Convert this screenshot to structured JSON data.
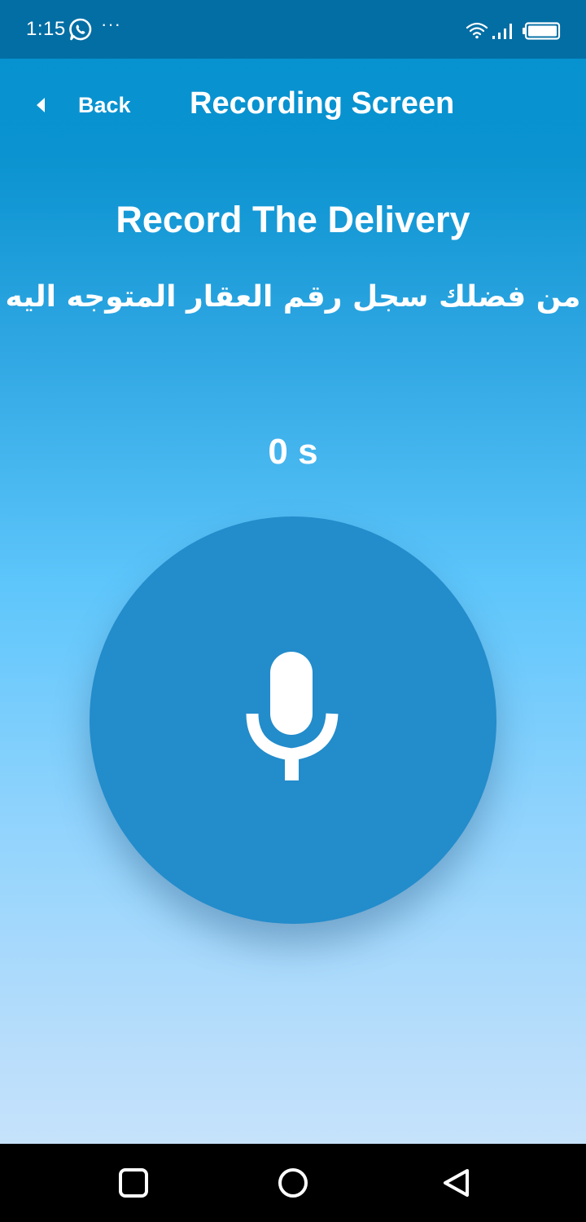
{
  "status_bar": {
    "time": "1:15",
    "more": "···",
    "icons": [
      "whatsapp-icon",
      "wifi-icon",
      "signal-icon",
      "battery-icon"
    ]
  },
  "header": {
    "back_label": "Back",
    "title": "Recording Screen"
  },
  "main": {
    "heading": "Record The Delivery",
    "instruction": "من فضلك سجل رقم العقار المتوجه اليه",
    "timer": "0 s"
  },
  "nav_bar": {
    "icons": [
      "recents-square-icon",
      "home-circle-icon",
      "back-triangle-icon"
    ]
  },
  "colors": {
    "status_bar": "#036ea4",
    "gradient_top": "#0591cf",
    "gradient_bottom": "#c6e2fb",
    "record_button": "#238ccb",
    "text": "#ffffff"
  }
}
